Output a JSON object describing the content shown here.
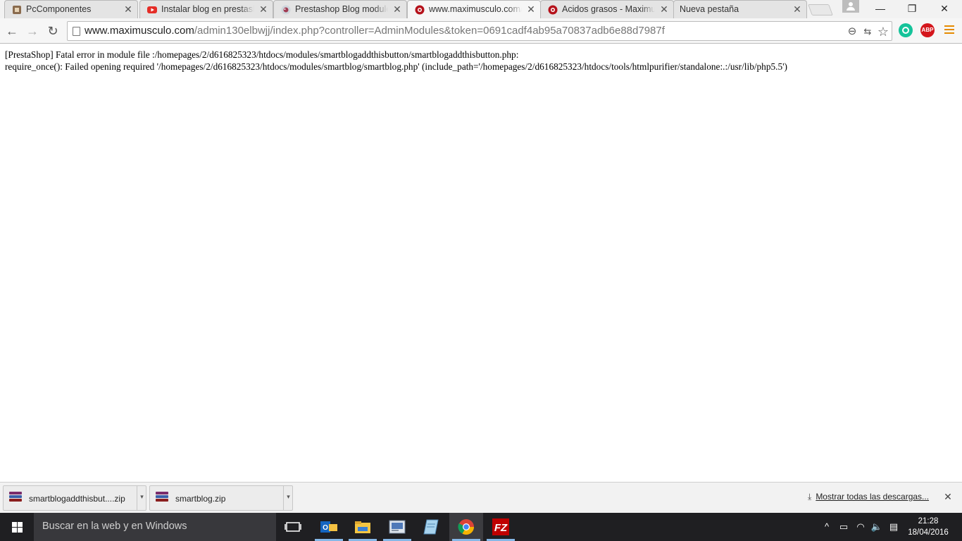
{
  "tabs": [
    {
      "title": "PcComponentes",
      "icon": "pccomponentes-favicon",
      "active": false
    },
    {
      "title": "Instalar blog en prestashop",
      "icon": "youtube-favicon",
      "active": false
    },
    {
      "title": "Prestashop Blog module",
      "icon": "prestashop-favicon",
      "active": false
    },
    {
      "title": "www.maximusculo.com/admin",
      "icon": "maximusculo-favicon",
      "active": true
    },
    {
      "title": "Acidos grasos - Maximusculo",
      "icon": "maximusculo-favicon",
      "active": false
    },
    {
      "title": "Nueva pestaña",
      "icon": "",
      "active": false
    }
  ],
  "tab_close": "✕",
  "window_controls": {
    "minimize": "—",
    "restore": "❐",
    "close": "✕"
  },
  "toolbar": {
    "back": "←",
    "forward": "→",
    "reload": "↻",
    "url_host": "www.maximusculo.com",
    "url_path": "/admin130elbwjj/index.php?controller=AdminModules&token=0691cadf4ab95a70837adb6e88d7987f",
    "zoom_icon": "⊖",
    "translate_icon": "⇆",
    "star_icon": "☆",
    "ext_abp_label": "ABP"
  },
  "error": {
    "line1": "[PrestaShop] Fatal error in module file :/homepages/2/d616825323/htdocs/modules/smartblogaddthisbutton/smartblogaddthisbutton.php:",
    "line2": "require_once(): Failed opening required '/homepages/2/d616825323/htdocs/modules/smartblog/smartblog.php' (include_path='/homepages/2/d616825323/htdocs/tools/htmlpurifier/standalone:.:/usr/lib/php5.5')"
  },
  "downloads": {
    "items": [
      {
        "name": "smartblogaddthisbut....zip"
      },
      {
        "name": "smartblog.zip"
      }
    ],
    "dropdown": "▾",
    "show_all": "Mostrar todas las descargas...",
    "close": "✕"
  },
  "taskbar": {
    "search_placeholder": "Buscar en la web y en Windows",
    "time": "21:28",
    "date": "18/04/2016",
    "tray": {
      "chevron": "^",
      "battery": "▭",
      "wifi": "◠",
      "volume": "🔈",
      "notifications": "▤"
    }
  },
  "colors": {
    "accent_chrome_menu": "#e58a00",
    "taskbar": "#1f1f22",
    "abp_red": "#d4161c",
    "grammarly_green": "#15c39a",
    "filezilla_red": "#bf0000"
  }
}
